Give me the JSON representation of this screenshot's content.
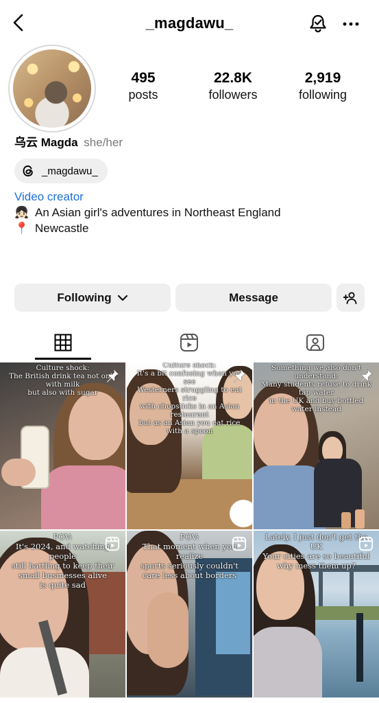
{
  "header": {
    "username": "_magdawu_",
    "back_icon": "chevron-left-icon",
    "bell_icon": "bell-check-icon",
    "more_icon": "more-horizontal-icon"
  },
  "profile": {
    "stats": [
      {
        "value": "495",
        "label": "posts"
      },
      {
        "value": "22.8K",
        "label": "followers"
      },
      {
        "value": "2,919",
        "label": "following"
      }
    ],
    "display_name": "乌云 Magda",
    "pronouns": "she/her",
    "threads_handle": "_magdawu_",
    "category": "Video creator",
    "bio": [
      {
        "emoji": "👧🏻",
        "text": "An Asian girl's adventures in Northeast England"
      },
      {
        "emoji": "📍",
        "text": "Newcastle"
      }
    ]
  },
  "actions": {
    "following_label": "Following",
    "message_label": "Message"
  },
  "tabs": [
    "grid-icon",
    "reels-icon",
    "tagged-icon"
  ],
  "posts": [
    {
      "caption": "Culture shock:\nThe British drink tea not only with milk\nbut also with sugar",
      "badge": "pin-icon"
    },
    {
      "caption": "Culture shock:\nIt's a bit confusing when you see\nWesterners struggling to eat rice\nwith chopsticks in an Asian restaurant\nbut as an Asian you eat rice with a spoon",
      "badge": "pin-icon"
    },
    {
      "caption": "Something we also don't understand:\nMany students refuse to drink tap water\nin the UK and buy bottled water instead",
      "badge": "pin-icon"
    },
    {
      "caption": "POV:\nIt's 2024, and watching people\nstill battling to keep their\nsmall businesses alive\nis quite sad",
      "badge": "reel-icon"
    },
    {
      "caption": "POV:\nThat moment when you realize\nsports seriously couldn't\ncare less about borders",
      "badge": "reel-icon"
    },
    {
      "caption": "Lately, I just don't get the UK\nYour cities are so beautiful\nwhy mess them up?",
      "badge": "reel-icon"
    }
  ],
  "colors": {
    "link": "#1b6fd6",
    "button_bg": "#efefef",
    "secondary_text": "#777777"
  }
}
